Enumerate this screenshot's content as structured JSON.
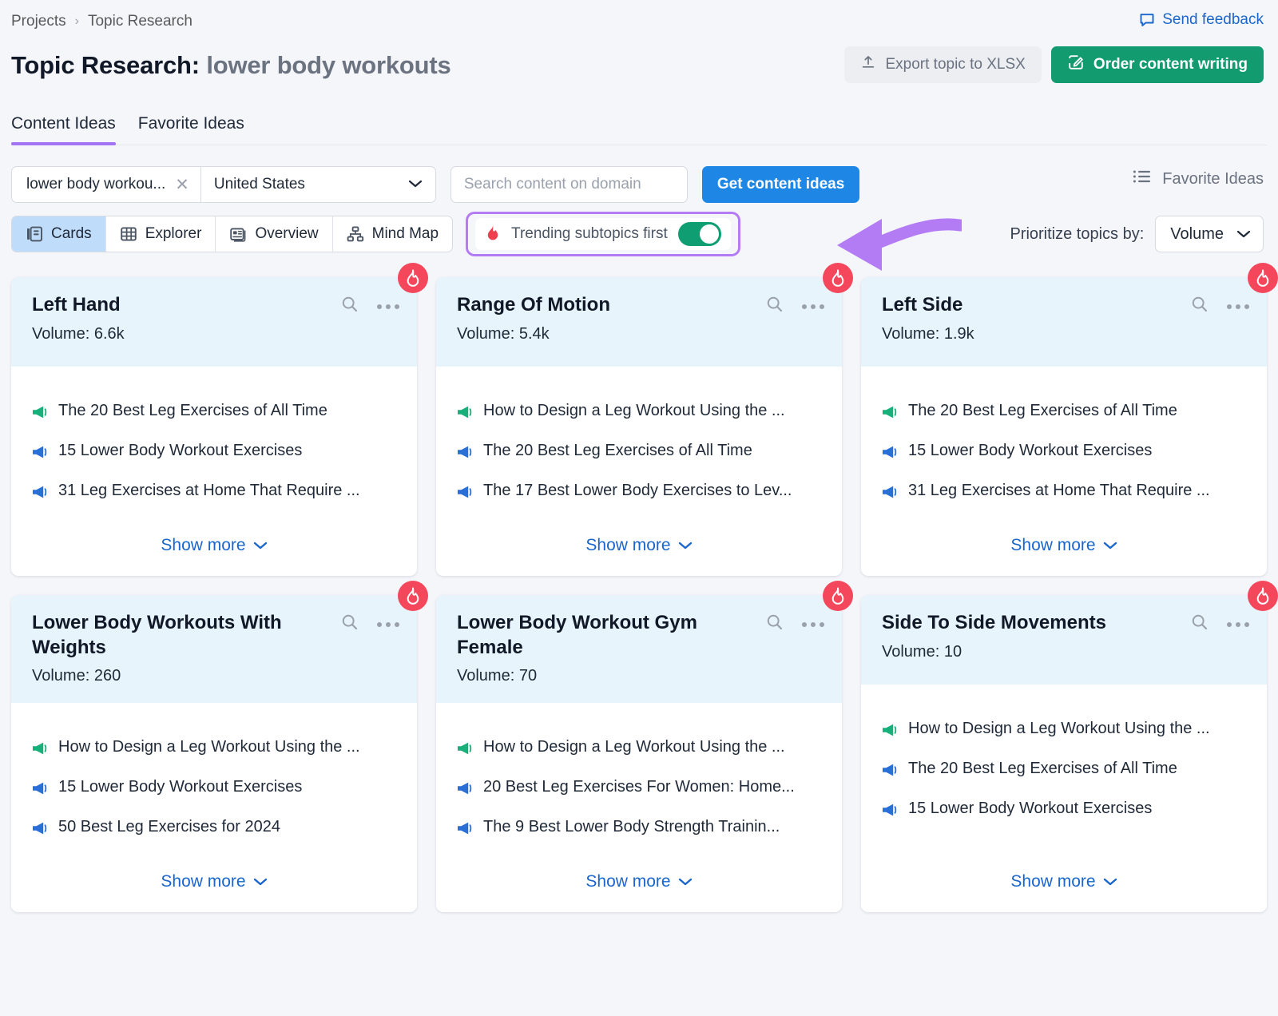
{
  "breadcrumb": {
    "root": "Projects",
    "current": "Topic Research",
    "separator": "›"
  },
  "feedback": {
    "label": "Send feedback",
    "icon": "comment-icon"
  },
  "header": {
    "title_prefix": "Topic Research:",
    "title_keyword": "lower body workouts",
    "export_label": "Export topic to XLSX",
    "order_label": "Order content writing"
  },
  "tabs": [
    {
      "label": "Content Ideas",
      "active": true
    },
    {
      "label": "Favorite Ideas",
      "active": false
    }
  ],
  "controls": {
    "keyword_chip": "lower body workou...",
    "clear_icon": "close-icon",
    "country": "United States",
    "domain_placeholder": "Search content on domain",
    "domain_value": "",
    "get_ideas_label": "Get content ideas",
    "favorite_ideas_label": "Favorite Ideas",
    "view_modes": [
      {
        "label": "Cards",
        "icon": "cards-icon",
        "active": true
      },
      {
        "label": "Explorer",
        "icon": "table-icon",
        "active": false
      },
      {
        "label": "Overview",
        "icon": "overview-icon",
        "active": false
      },
      {
        "label": "Mind Map",
        "icon": "mindmap-icon",
        "active": false
      }
    ],
    "trending_label": "Trending subtopics first",
    "trending_on": true,
    "prioritize_label": "Prioritize topics by:",
    "prioritize_value": "Volume"
  },
  "card_common": {
    "volume_prefix": "Volume: ",
    "show_more_label": "Show more",
    "search_icon": "search-icon",
    "more_icon": "more-options-icon",
    "trending_icon": "fire-icon",
    "chevron_icon": "chevron-down-icon"
  },
  "cards": [
    {
      "title": "Left Hand",
      "volume": "6.6k",
      "trending": true,
      "ideas": [
        {
          "text": "The 20 Best Leg Exercises of All Time",
          "color": "green"
        },
        {
          "text": "15 Lower Body Workout Exercises",
          "color": "blue"
        },
        {
          "text": "31 Leg Exercises at Home That Require ...",
          "color": "blue"
        }
      ]
    },
    {
      "title": "Range Of Motion",
      "volume": "5.4k",
      "trending": true,
      "ideas": [
        {
          "text": "How to Design a Leg Workout Using the ...",
          "color": "green"
        },
        {
          "text": "The 20 Best Leg Exercises of All Time",
          "color": "blue"
        },
        {
          "text": "The 17 Best Lower Body Exercises to Lev...",
          "color": "blue"
        }
      ]
    },
    {
      "title": "Left Side",
      "volume": "1.9k",
      "trending": true,
      "ideas": [
        {
          "text": "The 20 Best Leg Exercises of All Time",
          "color": "green"
        },
        {
          "text": "15 Lower Body Workout Exercises",
          "color": "blue"
        },
        {
          "text": "31 Leg Exercises at Home That Require ...",
          "color": "blue"
        }
      ]
    },
    {
      "title": "Lower Body Workouts With Weights",
      "volume": "260",
      "trending": true,
      "ideas": [
        {
          "text": "How to Design a Leg Workout Using the ...",
          "color": "green"
        },
        {
          "text": "15 Lower Body Workout Exercises",
          "color": "blue"
        },
        {
          "text": "50 Best Leg Exercises for 2024",
          "color": "blue"
        }
      ]
    },
    {
      "title": "Lower Body Workout Gym Female",
      "volume": "70",
      "trending": true,
      "ideas": [
        {
          "text": "How to Design a Leg Workout Using the ...",
          "color": "green"
        },
        {
          "text": "20 Best Leg Exercises For Women: Home...",
          "color": "blue"
        },
        {
          "text": "The 9 Best Lower Body Strength Trainin...",
          "color": "blue"
        }
      ]
    },
    {
      "title": "Side To Side Movements",
      "volume": "10",
      "trending": true,
      "ideas": [
        {
          "text": "How to Design a Leg Workout Using the ...",
          "color": "green"
        },
        {
          "text": "The 20 Best Leg Exercises of All Time",
          "color": "blue"
        },
        {
          "text": "15 Lower Body Workout Exercises",
          "color": "blue"
        }
      ]
    }
  ],
  "annotation": {
    "type": "arrow",
    "direction": "left",
    "color": "#b37cf5"
  },
  "colors": {
    "accent_purple": "#a273f2",
    "primary_blue": "#1e87e6",
    "green": "#129b6e",
    "fire_red": "#f4475b",
    "card_head_bg": "#e7f4fb",
    "link_blue": "#1a66cc"
  }
}
